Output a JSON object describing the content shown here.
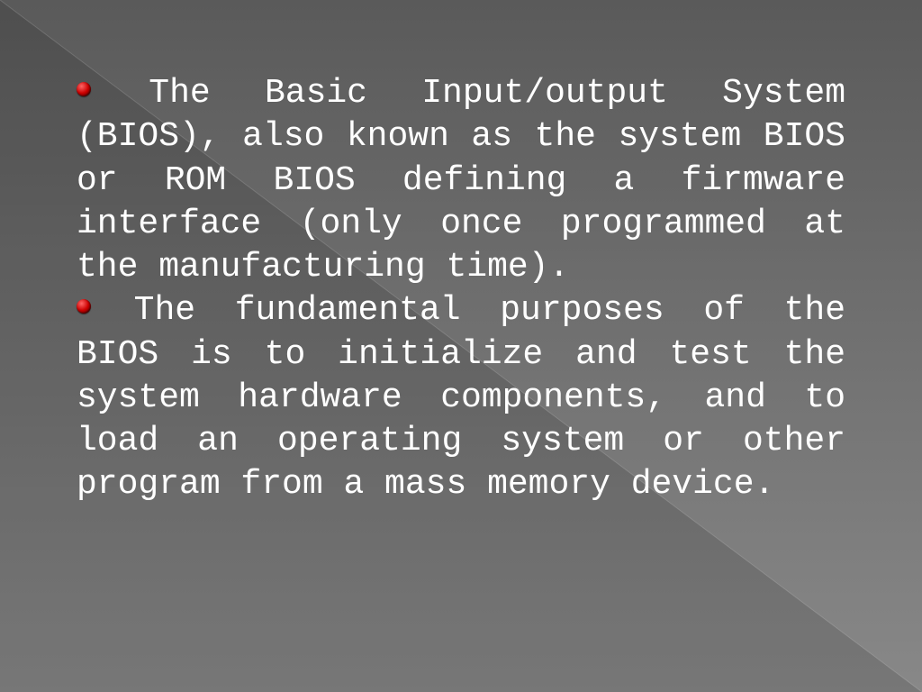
{
  "slide": {
    "bullets": [
      "The Basic Input/output System (BIOS), also known as the system BIOS or ROM BIOS defining a firmware interface (only once programmed at the manufacturing time).",
      "The fundamental purposes of the BIOS is to initialize and test the system hardware components, and to load an operating system or other program from a mass memory device."
    ]
  },
  "colors": {
    "text": "#ffffff",
    "bullet": "#cc0000"
  }
}
